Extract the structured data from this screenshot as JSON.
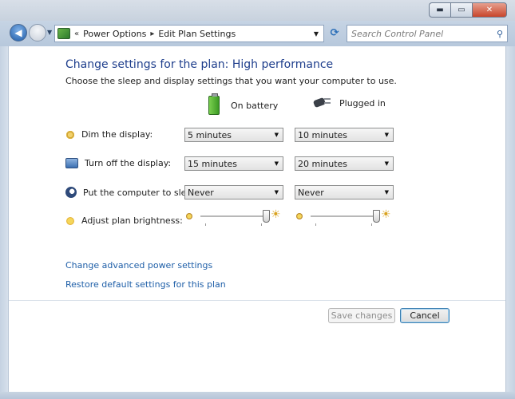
{
  "window": {
    "caption_buttons": {
      "minimize": "▬",
      "maximize": "▭",
      "close": "✕"
    }
  },
  "addressbar": {
    "crumbs": [
      "Power Options",
      "Edit Plan Settings"
    ],
    "prefix": "«",
    "separator": "▸"
  },
  "search": {
    "placeholder": "Search Control Panel"
  },
  "page": {
    "title": "Change settings for the plan: High performance",
    "subtitle": "Choose the sleep and display settings that you want your computer to use."
  },
  "columns": {
    "battery": "On battery",
    "plugged": "Plugged in"
  },
  "rows": {
    "dim": {
      "label": "Dim the display:",
      "battery": "5 minutes",
      "plugged": "10 minutes"
    },
    "off": {
      "label": "Turn off the display:",
      "battery": "15 minutes",
      "plugged": "20 minutes"
    },
    "sleep": {
      "label": "Put the computer to sleep:",
      "battery": "Never",
      "plugged": "Never"
    },
    "brightness": {
      "label": "Adjust plan brightness:",
      "battery_level": 1.0,
      "plugged_level": 1.0
    }
  },
  "links": {
    "advanced": "Change advanced power settings",
    "restore": "Restore default settings for this plan"
  },
  "buttons": {
    "save": "Save changes",
    "cancel": "Cancel"
  }
}
